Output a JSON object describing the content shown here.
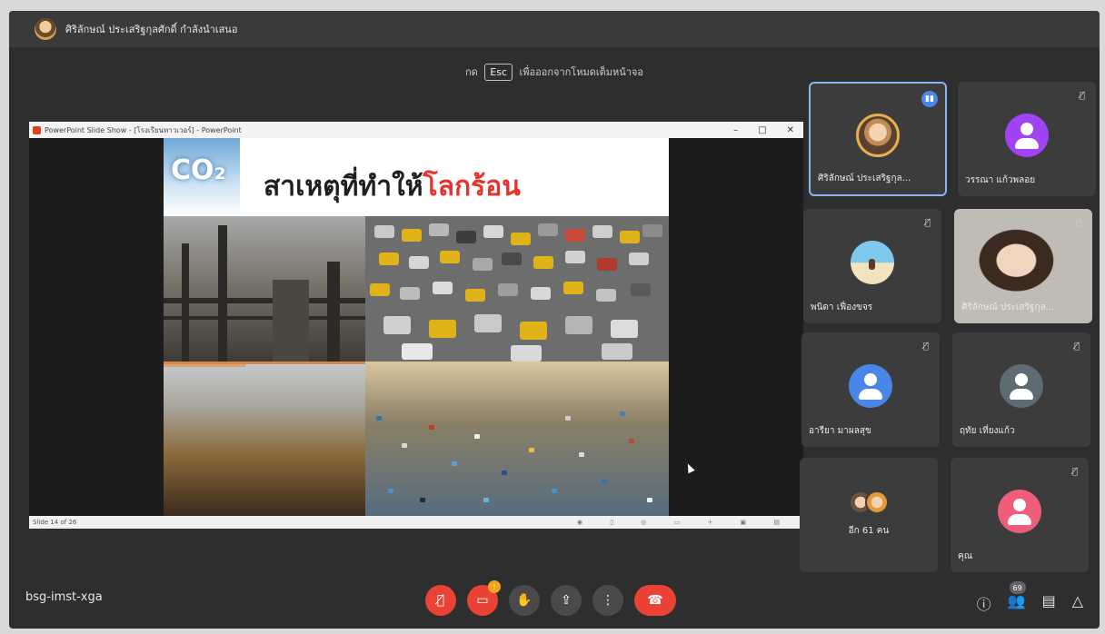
{
  "topbar": {
    "title": "ศิริลักษณ์ ประเสริฐกุลศักดิ์ กำลังนำเสนอ"
  },
  "esc_hint": {
    "before": "กด",
    "key": "Esc",
    "after": "เพื่อออกจากโหมดเต็มหน้าจอ"
  },
  "ppt": {
    "window_title": "PowerPoint Slide Show - [โรงเรียนทาวเวอร์] - PowerPoint",
    "controls": [
      "–",
      "□",
      "✕"
    ],
    "slide_title_black": "สาเหตุที่ทำให้",
    "slide_title_red": "โลกร้อน",
    "co2": "CO₂",
    "status_left": "Slide 14 of 26",
    "status_icons": "◉ ▯ ◎ ▭ + ▣ ▤"
  },
  "participants": [
    {
      "name": "ศิริลักษณ์ ประเสริฐกุล...",
      "avatar": "photo-avatar",
      "speaking": true,
      "muted": false
    },
    {
      "name": "วรรณา แก้วพลอย",
      "avatar": "person-icon",
      "color": "#a142f4",
      "muted": true
    },
    {
      "name": "พนิดา เฟื่องขจร",
      "avatar": "beach-photo",
      "muted": true
    },
    {
      "name": "ศิริลักษณ์ ประเสริฐกุล...",
      "avatar": "camera-video",
      "muted": true
    },
    {
      "name": "อารียา มาผลสุข",
      "avatar": "person-icon",
      "color": "#4a86e8",
      "muted": true
    },
    {
      "name": "ฤทัย เที่ยงแก้ว",
      "avatar": "person-icon",
      "color": "#5f6b73",
      "muted": true
    },
    {
      "name": "อีก 61 คน",
      "avatar": "grouped-avatars"
    },
    {
      "name": "คุณ",
      "avatar": "person-icon",
      "color": "#ee5e7b",
      "muted": true
    }
  ],
  "bottombar": {
    "meeting_code": "bsg-imst-xga",
    "mic_icon": "mic-off-icon",
    "cam_icon": "camera-off-icon",
    "cam_badge": "!",
    "participant_count": "69"
  },
  "colors": {
    "end_call": "#ea4335",
    "active_border": "#8ab4f8",
    "slide_red": "#e8322b"
  }
}
